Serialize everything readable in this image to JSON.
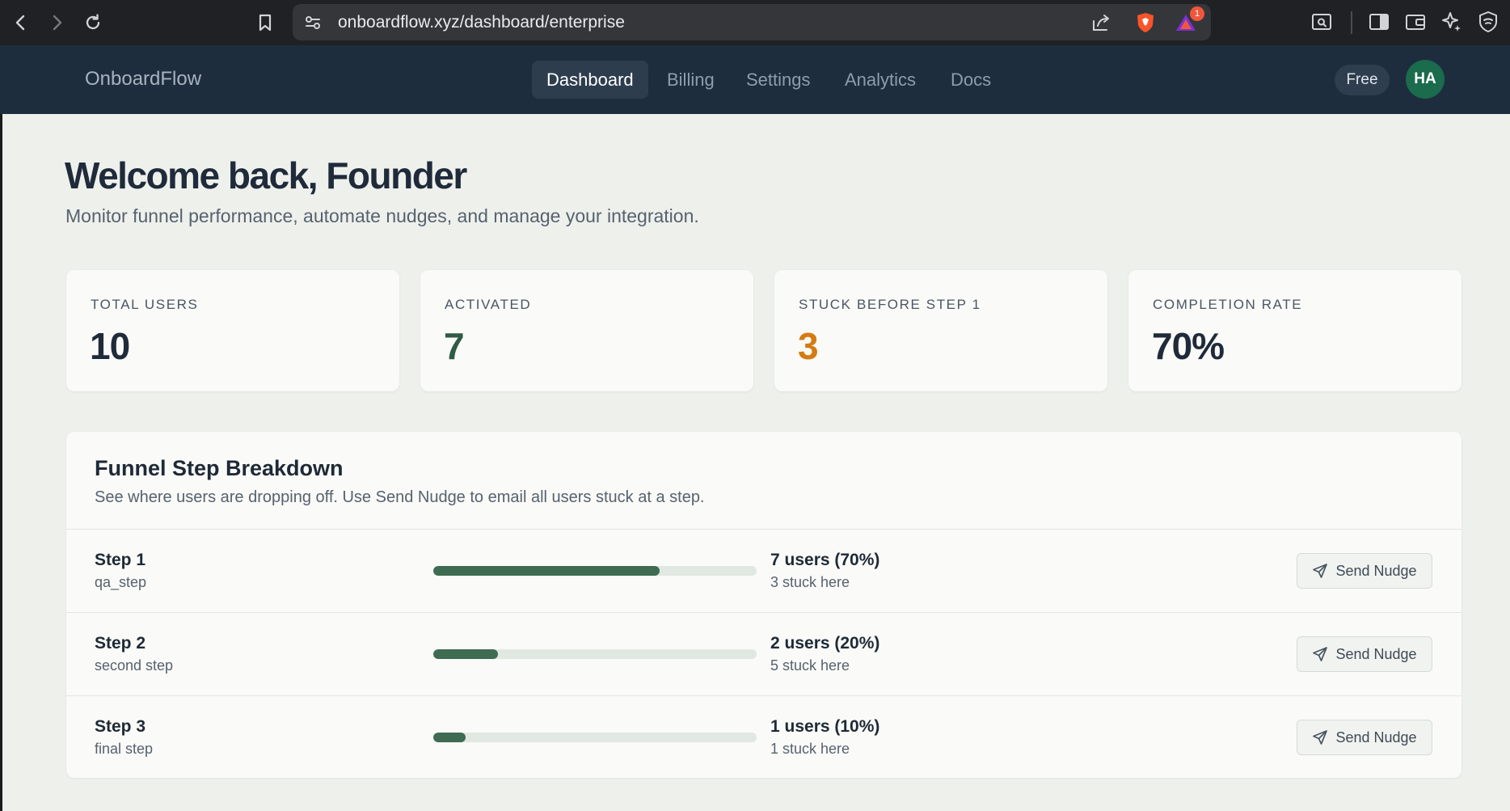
{
  "browser": {
    "url": "onboardflow.xyz/dashboard/enterprise",
    "notification_count": "1"
  },
  "header": {
    "brand": "OnboardFlow",
    "nav": [
      {
        "label": "Dashboard",
        "active": true
      },
      {
        "label": "Billing",
        "active": false
      },
      {
        "label": "Settings",
        "active": false
      },
      {
        "label": "Analytics",
        "active": false
      },
      {
        "label": "Docs",
        "active": false
      }
    ],
    "plan_badge": "Free",
    "avatar_initials": "HA"
  },
  "main": {
    "title": "Welcome back, Founder",
    "subtitle": "Monitor funnel performance, automate nudges, and manage your integration.",
    "stats": [
      {
        "label": "TOTAL USERS",
        "value": "10",
        "color": "#1f2b3a"
      },
      {
        "label": "ACTIVATED",
        "value": "7",
        "color": "#2f5a44"
      },
      {
        "label": "STUCK BEFORE STEP 1",
        "value": "3",
        "color": "#d47b12"
      },
      {
        "label": "COMPLETION RATE",
        "value": "70%",
        "color": "#1f2b3a"
      }
    ],
    "funnel": {
      "title": "Funnel Step Breakdown",
      "description": "See where users are dropping off. Use Send Nudge to email all users stuck at a step.",
      "steps": [
        {
          "name": "Step 1",
          "key": "qa_step",
          "users": "7 users (70%)",
          "stuck": "3 stuck here",
          "progress": 0.7,
          "button": "Send Nudge"
        },
        {
          "name": "Step 2",
          "key": "second step",
          "users": "2 users (20%)",
          "stuck": "5 stuck here",
          "progress": 0.2,
          "button": "Send Nudge"
        },
        {
          "name": "Step 3",
          "key": "final step",
          "users": "1 users (10%)",
          "stuck": "1 stuck here",
          "progress": 0.1,
          "button": "Send Nudge"
        }
      ]
    }
  },
  "colors": {
    "header_bg": "#1e2d3e",
    "accent_green": "#3e6b52",
    "warning_orange": "#d47b12",
    "avatar_green": "#1b6b4d"
  }
}
